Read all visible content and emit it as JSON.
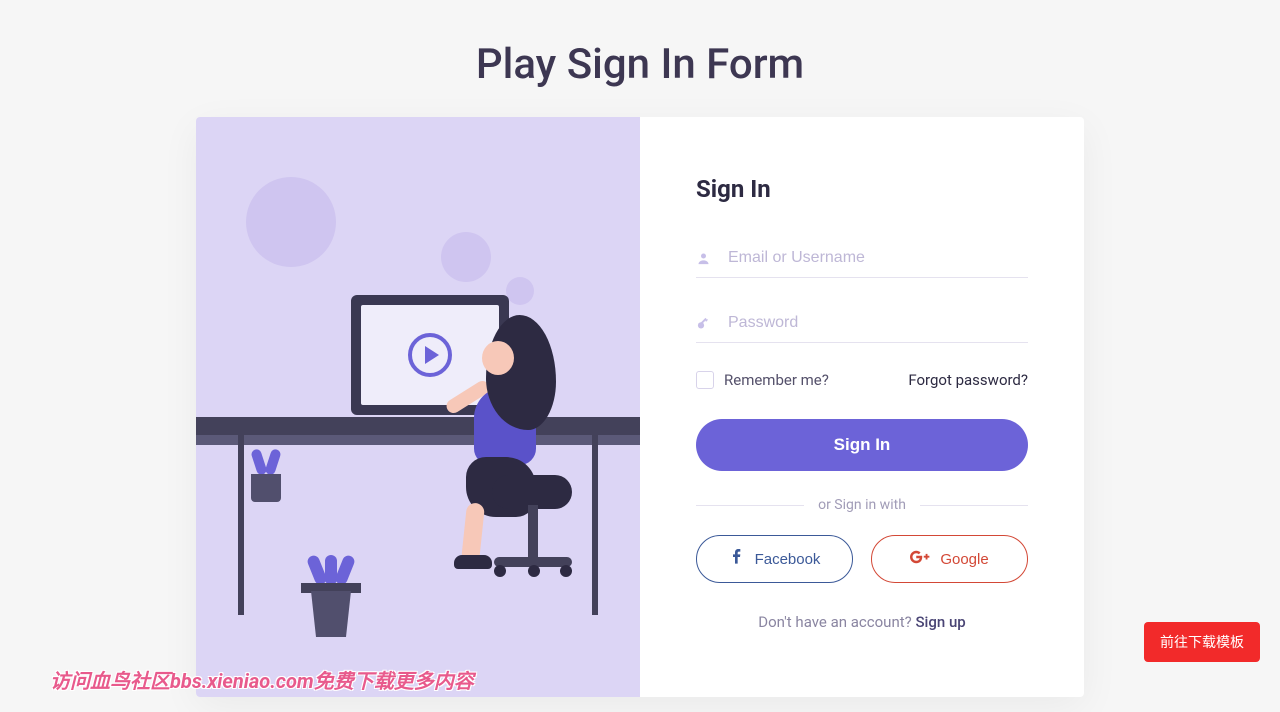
{
  "page_title": "Play Sign In Form",
  "form": {
    "heading": "Sign In",
    "email_placeholder": "Email or Username",
    "password_placeholder": "Password",
    "remember_label": "Remember me?",
    "forgot_label": "Forgot password?",
    "submit_label": "Sign In",
    "divider_text": "or Sign in with",
    "social": {
      "facebook": "Facebook",
      "google": "Google"
    },
    "signup_prompt": "Don't have an account? ",
    "signup_link": "Sign up"
  },
  "download_button": "前往下载模板",
  "watermark": "访问血鸟社区bbs.xieniao.com免费下载更多内容",
  "colors": {
    "primary": "#6c63d8",
    "facebook": "#3b5998",
    "google": "#d34836",
    "danger": "#f22a2a"
  }
}
